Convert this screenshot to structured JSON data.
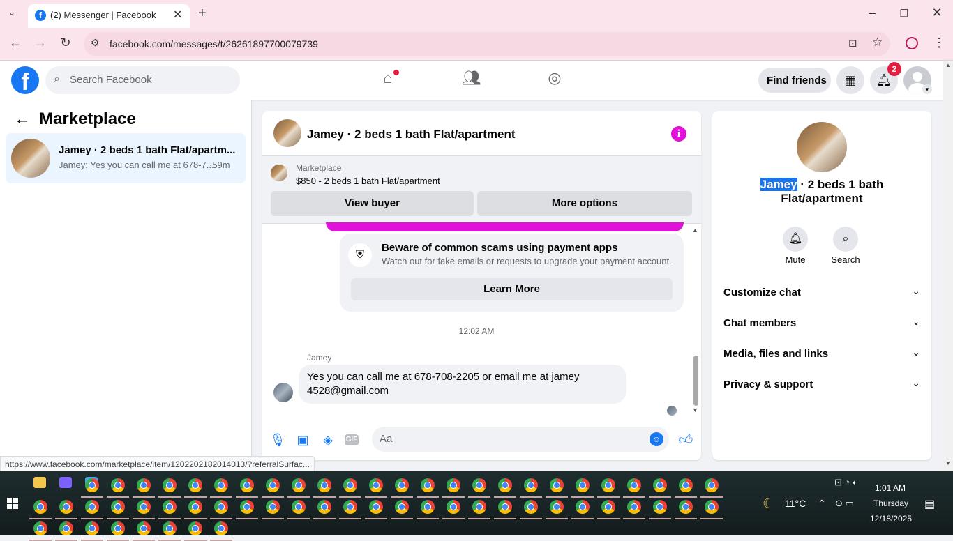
{
  "browser": {
    "tab_title": "(2) Messenger | Facebook",
    "url": "facebook.com/messages/t/26261897700079739",
    "status_url": "https://www.facebook.com/marketplace/item/1202202182014013/?referralSurfac..."
  },
  "header": {
    "search_placeholder": "Search Facebook",
    "find_friends": "Find friends",
    "notification_count": "2"
  },
  "left": {
    "title": "Marketplace",
    "conversation": {
      "name": "Jamey · 2 beds 1 bath Flat/apartm...",
      "preview": "Jamey: Yes you can call me at 678-7...",
      "time": "·59m"
    }
  },
  "chat": {
    "title": "Jamey · 2 beds 1 bath Flat/apartment",
    "marketplace_label": "Marketplace",
    "listing": "$850 - 2 beds 1 bath Flat/apartment",
    "view_buyer": "View buyer",
    "more_options": "More options",
    "scam_title": "Beware of common scams using payment apps",
    "scam_sub": "Watch out for fake emails or requests to upgrade your payment account.",
    "learn_more": "Learn More",
    "timestamp": "12:02 AM",
    "sender": "Jamey",
    "message": "Yes you can call me at 678-708-2205 or email me at jamey 4528@gmail.com",
    "composer_placeholder": "Aa"
  },
  "right": {
    "name_highlight": "Jamey",
    "title_rest": " · 2 beds 1 bath Flat/apartment",
    "mute": "Mute",
    "search": "Search",
    "sections": [
      "Customize chat",
      "Chat members",
      "Media, files and links",
      "Privacy & support"
    ]
  },
  "taskbar": {
    "temp": "11°C",
    "time": "1:01 AM",
    "day": "Thursday",
    "date": "12/18/2025"
  },
  "colors": {
    "fb_blue": "#1877f2",
    "messenger_pink": "#e011d9",
    "badge_red": "#e41e3f"
  }
}
